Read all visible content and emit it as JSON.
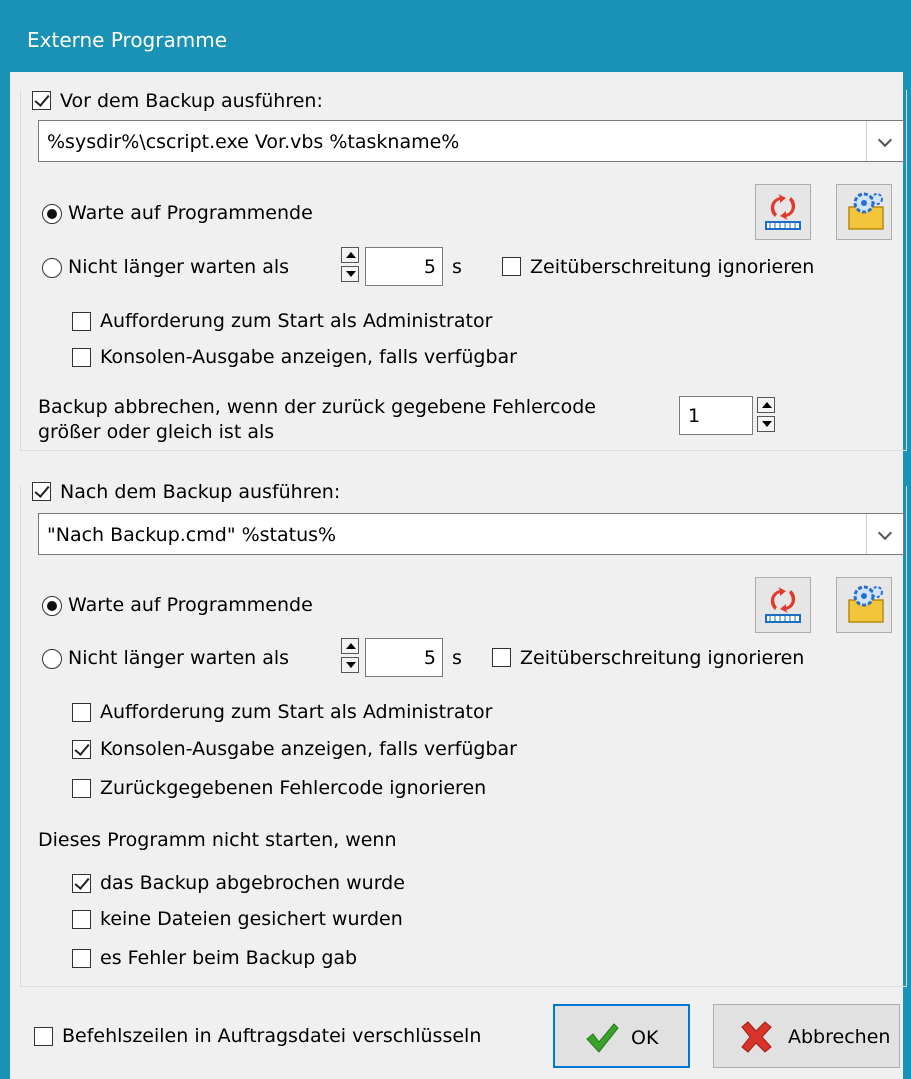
{
  "window": {
    "title": "Externe Programme"
  },
  "before": {
    "enabled_label": "Vor dem Backup ausführen:",
    "command": "%sysdir%\\cscript.exe Vor.vbs %taskname%",
    "wait_label": "Warte auf Programmende",
    "timeout_label": "Nicht länger warten als",
    "timeout_value": "5",
    "timeout_unit": "s",
    "ignore_timeout_label": "Zeitüberschreitung ignorieren",
    "admin_label": "Aufforderung zum Start als Administrator",
    "console_label": "Konsolen-Ausgabe anzeigen, falls verfügbar",
    "abort_line1": "Backup abbrechen, wenn der zurück gegebene Fehlercode",
    "abort_line2": "größer oder gleich ist als",
    "abort_code": "1"
  },
  "after": {
    "enabled_label": "Nach dem Backup ausführen:",
    "command": "\"Nach Backup.cmd\" %status%",
    "wait_label": "Warte auf Programmende",
    "timeout_label": "Nicht länger warten als",
    "timeout_value": "5",
    "timeout_unit": "s",
    "ignore_timeout_label": "Zeitüberschreitung ignorieren",
    "admin_label": "Aufforderung zum Start als Administrator",
    "console_label": "Konsolen-Ausgabe anzeigen, falls verfügbar",
    "ignore_error_label": "Zurückgegebenen Fehlercode ignorieren",
    "skip_heading": "Dieses Programm nicht starten, wenn",
    "skip_aborted_label": "das Backup abgebrochen wurde",
    "skip_nofiles_label": "keine Dateien gesichert wurden",
    "skip_errors_label": "es Fehler beim Backup gab"
  },
  "footer": {
    "encrypt_label": "Befehlszeilen in Auftragsdatei verschlüsseln",
    "ok_label": "OK",
    "cancel_label": "Abbrechen"
  },
  "state": {
    "before_enabled": true,
    "before_wait": true,
    "before_ignore_timeout": false,
    "before_admin": false,
    "before_console": false,
    "after_enabled": true,
    "after_wait": true,
    "after_ignore_timeout": false,
    "after_admin": false,
    "after_console": true,
    "after_ignore_error": false,
    "skip_aborted": true,
    "skip_nofiles": false,
    "skip_errors": false,
    "encrypt": false
  },
  "colors": {
    "titlebar": "#1a91b6",
    "accent": "#0078d7",
    "ok_check": "#3aa12a",
    "cancel_x": "#d9342b"
  },
  "icons": [
    "checkbox-icon",
    "radio-icon",
    "chevron-down-icon",
    "run-test-icon",
    "settings-gear-icon",
    "ok-check-icon",
    "cancel-x-icon",
    "spin-up-icon",
    "spin-down-icon"
  ]
}
